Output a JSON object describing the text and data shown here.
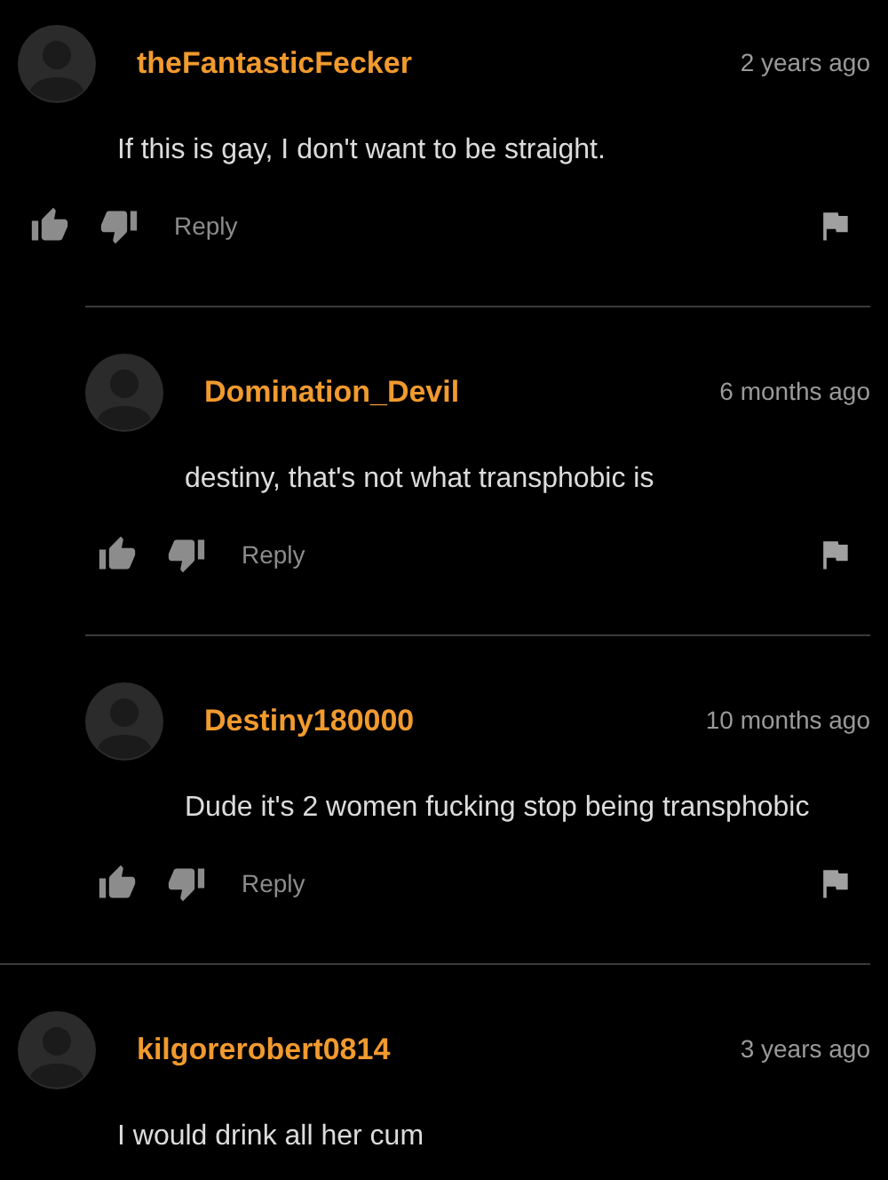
{
  "comments": [
    {
      "user": "theFantasticFecker",
      "time": "2 years ago",
      "text": "If this is gay, I don't want to be straight.",
      "reply": "Reply",
      "replies": [
        {
          "user": "Domination_Devil",
          "time": "6 months ago",
          "text": "destiny, that's not what transphobic is",
          "reply": "Reply"
        },
        {
          "user": "Destiny180000",
          "time": "10 months ago",
          "text": "Dude it's 2 women fucking stop being transphobic",
          "reply": "Reply"
        }
      ]
    },
    {
      "user": "kilgorerobert0814",
      "time": "3 years ago",
      "text": "I would drink all her cum"
    }
  ]
}
